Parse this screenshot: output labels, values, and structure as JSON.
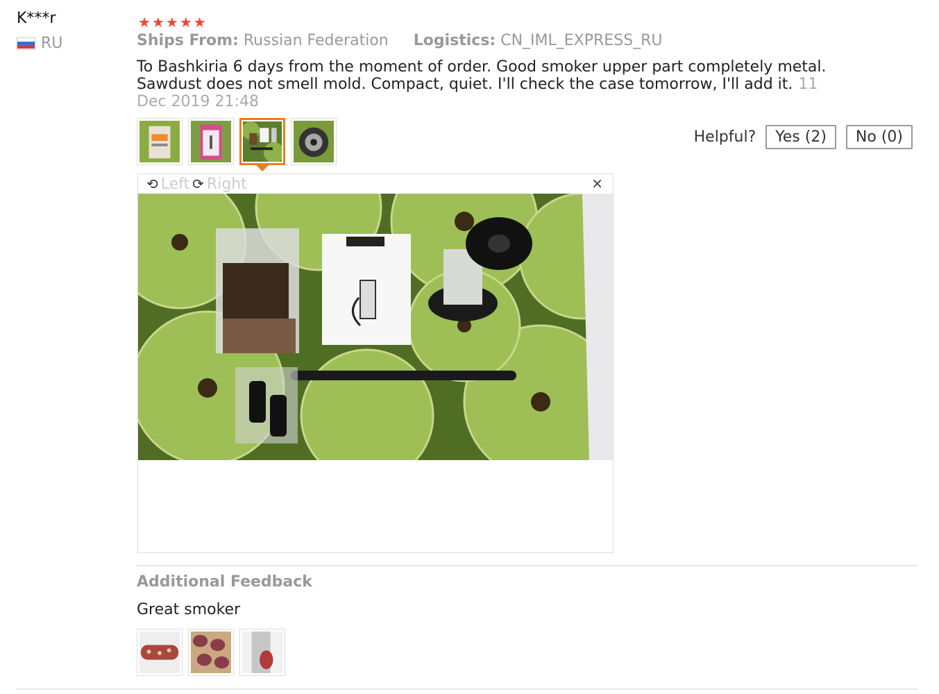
{
  "reviewer": {
    "name": "K***r",
    "country": "RU"
  },
  "rating": {
    "stars": 5,
    "max": 5
  },
  "shipping": {
    "ships_from_label": "Ships From:",
    "ships_from_value": "Russian Federation",
    "logistics_label": "Logistics:",
    "logistics_value": "CN_IML_EXPRESS_RU"
  },
  "review": {
    "text": "To Bashkiria 6 days from the moment of order. Good smoker upper part completely metal. Sawdust does not smell mold. Compact, quiet. I'll check the case tomorrow, I'll add it.",
    "date": "11 Dec 2019 21:48"
  },
  "helpful": {
    "label": "Helpful?",
    "yes_label": "Yes (2)",
    "no_label": "No (0)"
  },
  "viewer": {
    "rotate_left": "Left",
    "rotate_right": "Right",
    "close": "×",
    "selected_index": 2
  },
  "additional": {
    "title": "Additional Feedback",
    "text": "Great smoker"
  },
  "icons": {
    "star": "star-icon",
    "rotate_left": "rotate-left-icon",
    "rotate_right": "rotate-right-icon",
    "close": "close-icon",
    "flag": "russia-flag-icon"
  },
  "colors": {
    "star": "#f44336",
    "active_thumb": "#f07c1a",
    "muted_text": "#999999"
  }
}
